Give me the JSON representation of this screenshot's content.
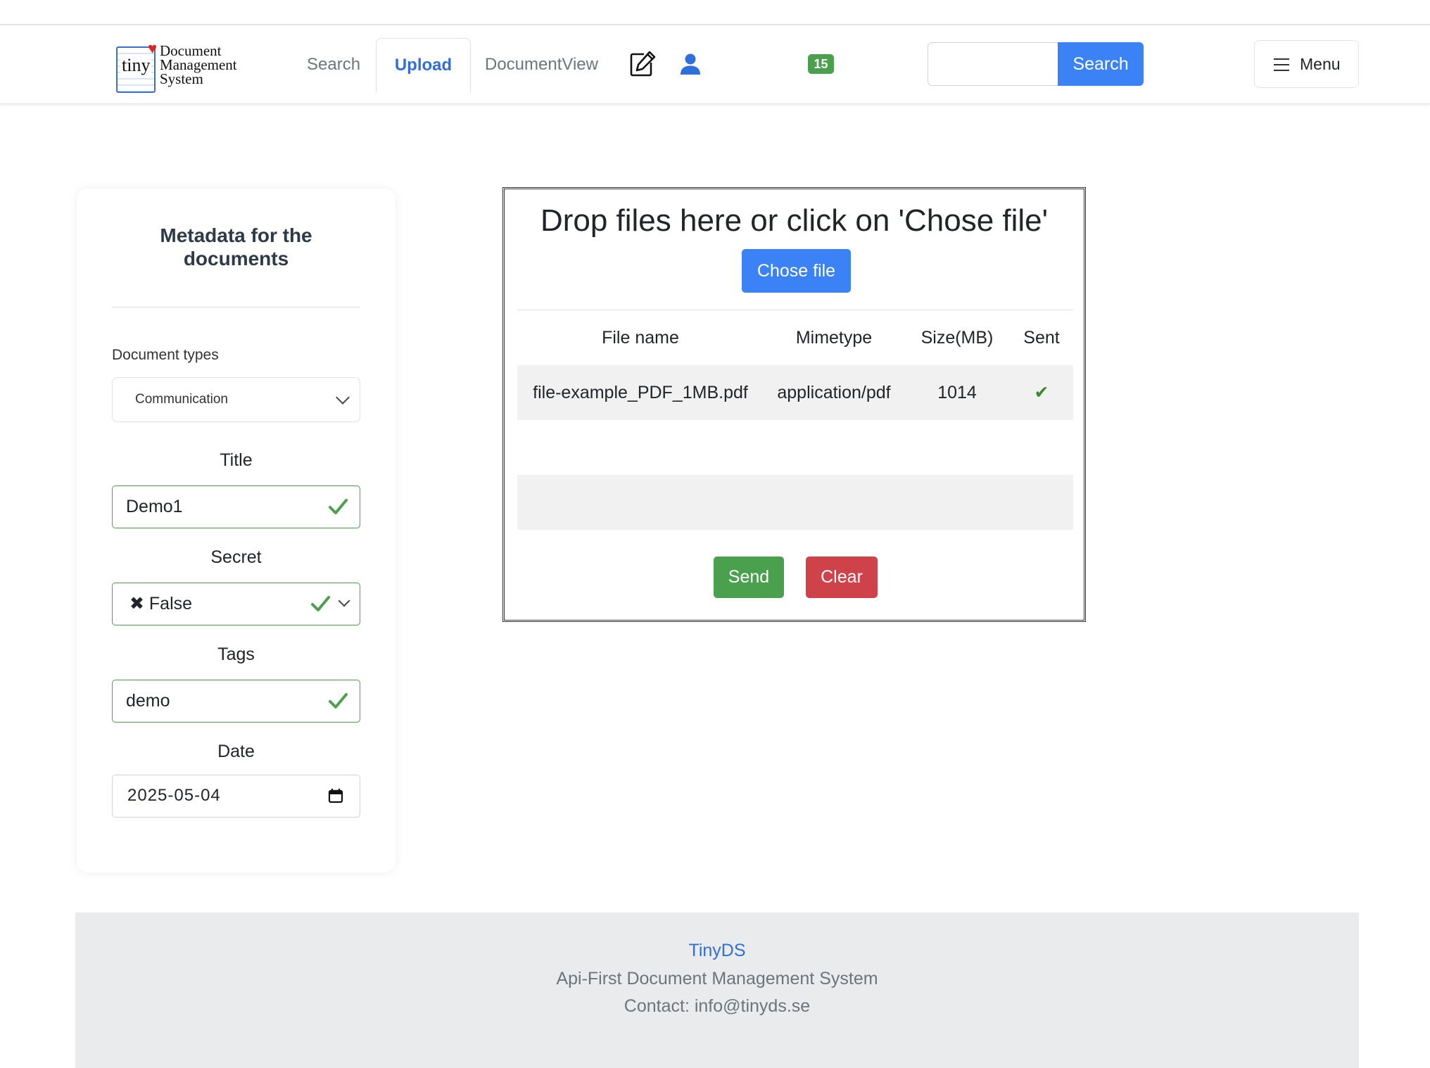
{
  "nav": {
    "logo": {
      "small": "tiny",
      "line1": "Document",
      "line2": "Management",
      "line3": "System"
    },
    "links": {
      "search": "Search",
      "upload": "Upload",
      "documentview": "DocumentView"
    },
    "badge_count": "15",
    "search": {
      "value": "",
      "button": "Search"
    },
    "menu_label": "Menu"
  },
  "sidebar": {
    "title_line1": "Metadata for the",
    "title_line2": "documents",
    "doc_types_label": "Document types",
    "doc_types_value": "Communication",
    "title_label": "Title",
    "title_value": "Demo1",
    "secret_label": "Secret",
    "secret_value": "✖ False",
    "tags_label": "Tags",
    "tags_value": "demo",
    "date_label": "Date",
    "date_value": "2025-05-04"
  },
  "upload": {
    "drop_text": "Drop files here or click on 'Chose file'",
    "chose_button": "Chose file",
    "columns": [
      "File name",
      "Mimetype",
      "Size(MB)",
      "Sent"
    ],
    "rows": [
      {
        "name": "file-example_PDF_1MB.pdf",
        "mimetype": "application/pdf",
        "size": "1014",
        "sent": "✔"
      }
    ],
    "send_button": "Send",
    "clear_button": "Clear"
  },
  "footer": {
    "brand": "TinyDS",
    "tagline": "Api-First Document Management System",
    "contact": "Contact: info@tinyds.se"
  },
  "colors": {
    "primary": "#3b82f6",
    "success": "#4aa04d",
    "danger": "#d0424a",
    "link": "#2f6fdb"
  }
}
